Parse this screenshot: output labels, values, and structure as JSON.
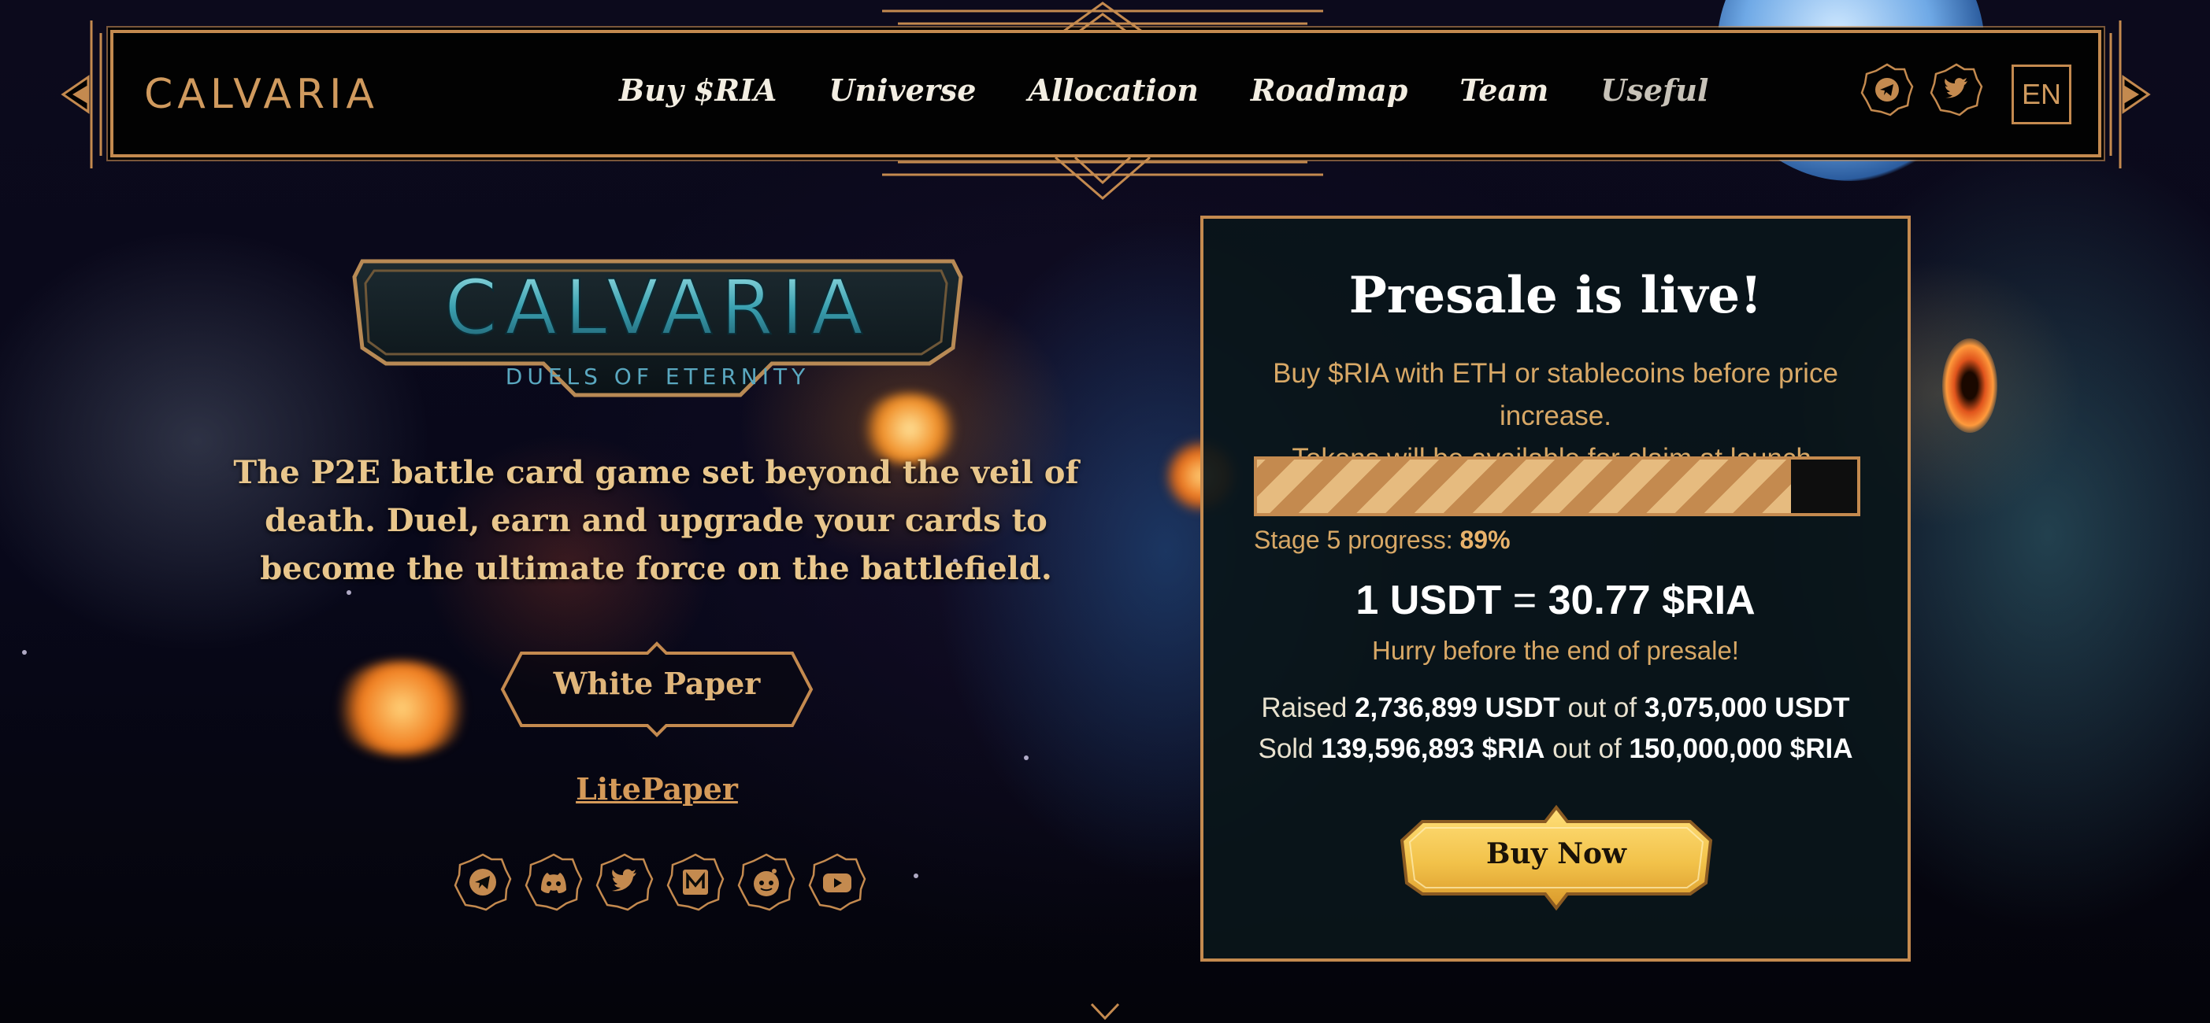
{
  "nav": {
    "logo": "CALVARIA",
    "links": [
      "Buy $RIA",
      "Universe",
      "Allocation",
      "Roadmap",
      "Team",
      "Useful"
    ],
    "icons": [
      "telegram-icon",
      "twitter-icon"
    ],
    "language": "EN"
  },
  "hero": {
    "logo_title": "CALVARIA",
    "logo_subtitle": "DUELS OF ETERNITY",
    "tagline": "The P2E battle card game set beyond the veil of death. Duel, earn and upgrade your cards to become the ultimate force on the battlefield.",
    "white_paper": "White Paper",
    "lite_paper": "LitePaper",
    "socials": [
      "telegram-icon",
      "discord-icon",
      "twitter-icon",
      "medium-icon",
      "reddit-icon",
      "youtube-icon"
    ]
  },
  "presale": {
    "title": "Presale is live!",
    "subtitle_line1": "Buy $RIA with ETH or stablecoins before price increase.",
    "subtitle_line2": "Tokens will be available for claim at launch.",
    "progress_fraction": 0.89,
    "stage_label": "Stage 5 progress:",
    "stage_value": "89%",
    "rate_left": "1 USDT",
    "rate_eq": "=",
    "rate_right": "30.77 $RIA",
    "hurry": "Hurry before the end of presale!",
    "raised_label": "Raised",
    "raised_value": "2,736,899 USDT",
    "raised_out_of": "out of",
    "raised_total": "3,075,000 USDT",
    "sold_label": "Sold",
    "sold_value": "139,596,893 $RIA",
    "sold_out_of": "out of",
    "sold_total": "150,000,000 $RIA",
    "buy_button": "Buy Now"
  },
  "colors": {
    "gold": "#c48a4f",
    "gold_text": "#d8a866",
    "button_yellow": "#f2c24a",
    "nav_bg": "#020202",
    "card_bg": "#0a161a"
  }
}
